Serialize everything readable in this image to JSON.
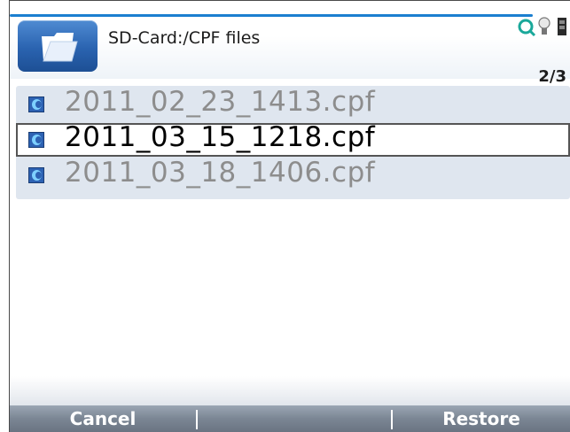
{
  "header": {
    "path": "SD-Card:/CPF files",
    "page_counter": "2/3",
    "icons": [
      "folder-icon",
      "search-icon",
      "lightbulb-icon",
      "battery-icon"
    ]
  },
  "file_list": {
    "items": [
      {
        "name": "2011_02_23_1413.cpf",
        "selected": false,
        "icon": "cpf-file-icon"
      },
      {
        "name": "2011_03_15_1218.cpf",
        "selected": true,
        "icon": "cpf-file-icon"
      },
      {
        "name": "2011_03_18_1406.cpf",
        "selected": false,
        "icon": "cpf-file-icon"
      }
    ]
  },
  "softkeys": {
    "left": "Cancel",
    "middle": "",
    "right": "Restore"
  },
  "colors": {
    "accent_blue": "#1b7fd0",
    "list_background": "#dfe6ef",
    "softkey_bar": "#7b8694",
    "selected_text": "#000000",
    "unselected_text": "#8d8d8d"
  }
}
